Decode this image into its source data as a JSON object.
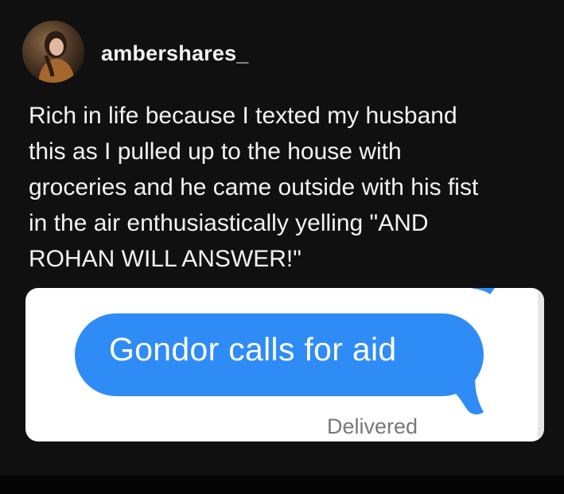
{
  "post": {
    "username": "ambershares_",
    "caption_lines": [
      "Rich in life because I texted my husband",
      "this as I pulled up to the house with",
      "groceries and he came outside with his fist",
      "in the air enthusiastically yelling \"AND",
      "ROHAN WILL ANSWER!\""
    ]
  },
  "message": {
    "text": "Gondor calls for aid",
    "status": "Delivered"
  },
  "colors": {
    "background": "#101010",
    "bubble": "#2f8cf6",
    "card": "#ffffff"
  },
  "icons": {
    "avatar": "profile-photo"
  }
}
